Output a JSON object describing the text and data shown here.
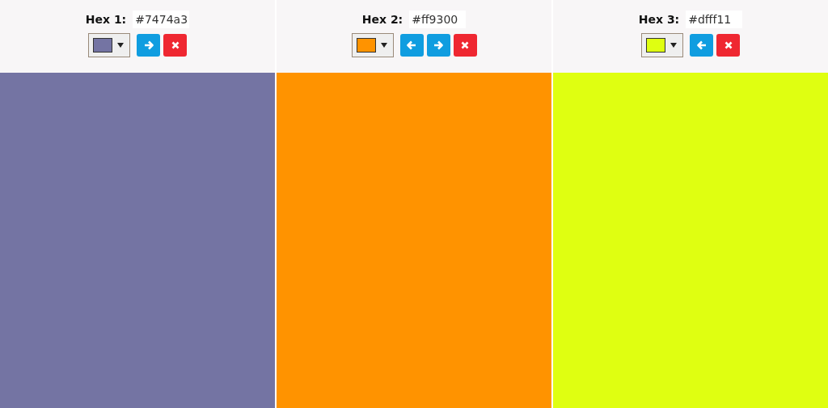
{
  "columns": [
    {
      "label": "Hex 1:",
      "value": "#7474a3",
      "color": "#7474a3",
      "move_left": false,
      "move_right": true
    },
    {
      "label": "Hex 2:",
      "value": "#ff9300",
      "color": "#ff9300",
      "move_left": true,
      "move_right": true
    },
    {
      "label": "Hex 3:",
      "value": "#dfff11",
      "color": "#dfff11",
      "move_left": true,
      "move_right": false
    }
  ]
}
